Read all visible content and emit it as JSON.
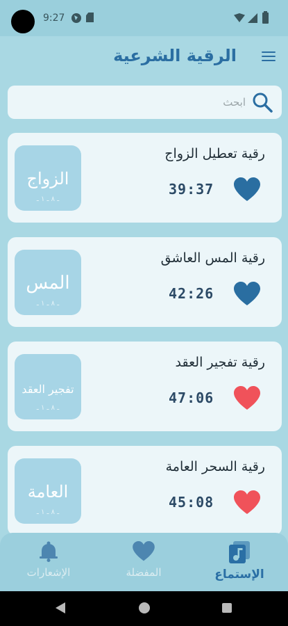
{
  "status_bar": {
    "time": "9:27"
  },
  "app_bar": {
    "title": "الرقية الشرعية"
  },
  "search": {
    "placeholder": "ابحث",
    "value": ""
  },
  "tracks": [
    {
      "title": "رقية تعطيل الزواج",
      "duration": "39:37",
      "favorite": false,
      "heart_color": "#2a6ea1",
      "thumb_text": "الزواج"
    },
    {
      "title": "رقية المس العاشق",
      "duration": "42:26",
      "favorite": false,
      "heart_color": "#2a6ea1",
      "thumb_text": "المس"
    },
    {
      "title": "رقية تفجير العقد",
      "duration": "47:06",
      "favorite": true,
      "heart_color": "#f0525a",
      "thumb_text": "تفجير العقد"
    },
    {
      "title": "رقية السحر العامة",
      "duration": "45:08",
      "favorite": true,
      "heart_color": "#f0525a",
      "thumb_text": "العامة"
    }
  ],
  "bottom_nav": {
    "listen": {
      "label": "الإستماع",
      "icon": "music-note-icon",
      "active": true
    },
    "favorites": {
      "label": "المفضلة",
      "icon": "heart-icon",
      "active": false
    },
    "notifications": {
      "label": "الإشعارات",
      "icon": "bell-icon",
      "active": false
    }
  },
  "colors": {
    "accent": "#2b6ea2",
    "background": "#a9d8e3",
    "card": "#ecf6f9",
    "favorite_red": "#f0525a"
  }
}
